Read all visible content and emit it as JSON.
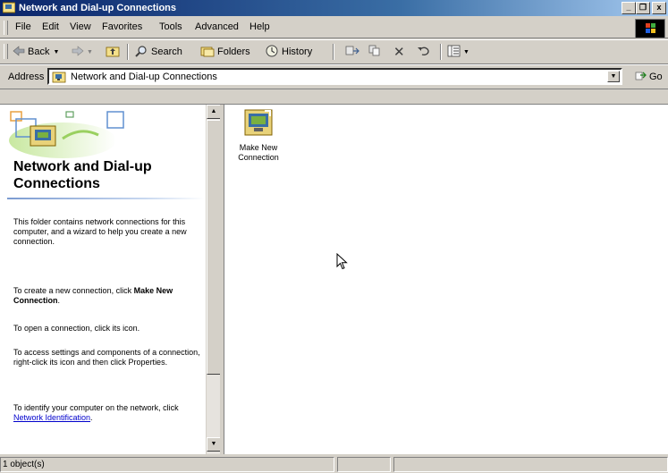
{
  "window": {
    "title": "Network and Dial-up Connections",
    "controls": [
      "_",
      "❐",
      "x"
    ]
  },
  "menubar": {
    "items": [
      "File",
      "Edit",
      "View",
      "Favorites",
      "Tools",
      "Advanced",
      "Help"
    ]
  },
  "toolbar": {
    "back": "Back",
    "search": "Search",
    "folders": "Folders",
    "history": "History"
  },
  "address": {
    "label": "Address",
    "value": "Network and Dial-up Connections",
    "go": "Go"
  },
  "left_pane": {
    "title": "Network and Dial-up Connections",
    "para1": "This folder contains network connections for this computer, and a wizard to help you create a new connection.",
    "para2_prefix": "To create a new connection, click",
    "para2_bold": "Make New Connection",
    "para3": "To open a connection, click its icon.",
    "para4": "To access settings and components of a connection, right-click its icon and then click Properties.",
    "para5_prefix": "To identify your computer on the network, click",
    "para5_link": "Network Identification"
  },
  "items": [
    {
      "label": "Make New Connection",
      "icon": "make-new-connection-icon"
    }
  ],
  "statusbar": {
    "text": "1 object(s)"
  }
}
